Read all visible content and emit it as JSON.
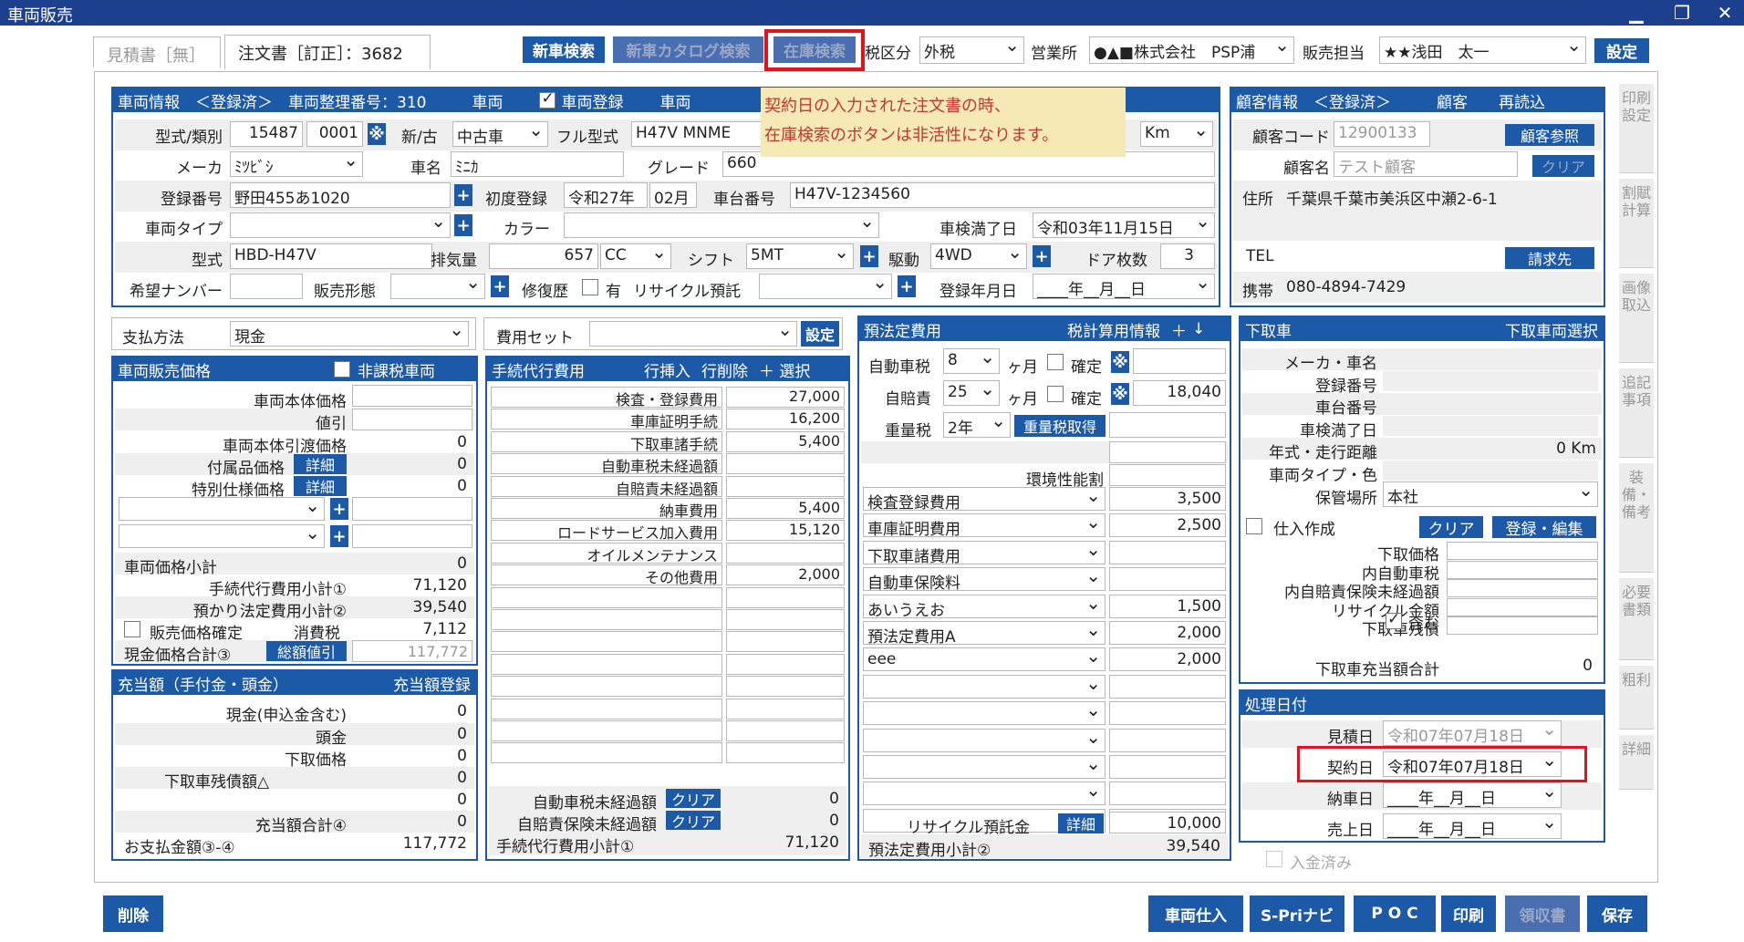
{
  "window": {
    "title": "車両販売",
    "minimize": "▁",
    "restore": "❐",
    "close": "✕"
  },
  "tabs": [
    {
      "label": "見積書［無］"
    },
    {
      "label": "注文書［訂正］：3682"
    }
  ],
  "toolbar": {
    "new_car_search": "新車検索",
    "catalog_search": "新車カタログ検索",
    "stock_search": "在庫検索",
    "tax_label": "税区分",
    "tax_value": "外税",
    "office_label": "営業所",
    "office_value": "●▲■株式会社　PSP浦",
    "sales_label": "販売担当",
    "sales_value": "★★浅田　太一",
    "settings": "設定"
  },
  "tooltip": {
    "line1": "契約日の入力された注文書の時、",
    "line2": "在庫検索のボタンは非活性になります。"
  },
  "vehicle": {
    "header": "車両情報　＜登録済＞　車両整理番号：310",
    "h_vehicle": "車両",
    "h_reg": "車両登録",
    "h_vehicle2": "車両",
    "type_label": "型式/類別",
    "type1": "15487",
    "type2": "0001",
    "newold_label": "新/古",
    "newold": "中古車",
    "full_type_label": "フル型式",
    "full_type": "H47V MNME",
    "unit": "Km",
    "maker_label": "メーカ",
    "maker": "ﾐﾂﾋﾞｼ",
    "name_label": "車名",
    "name": "ﾐﾆｶ",
    "grade_label": "グレード",
    "grade": "660",
    "regno_label": "登録番号",
    "regno": "野田455あ1020",
    "first_reg_label": "初度登録",
    "first_reg_era": "令和27年",
    "first_reg_month": "02月",
    "chassis_label": "車台番号",
    "chassis": "H47V-1234560",
    "vtype_label": "車両タイプ",
    "color_label": "カラー",
    "inspection_label": "車検満了日",
    "inspection": "令和03年11月15日",
    "model_label": "型式",
    "model": "HBD-H47V",
    "displacement_label": "排気量",
    "displacement": "657",
    "cc": "CC",
    "shift_label": "シフト",
    "shift": "5MT",
    "drive_label": "駆動",
    "drive": "4WD",
    "doors_label": "ドア枚数",
    "doors": "3",
    "wish_label": "希望ナンバー",
    "sales_form_label": "販売形態",
    "repair_label": "修復歴",
    "repair_has": "有",
    "recycle_label": "リサイクル預託",
    "reg_date_label": "登録年月日",
    "reg_date": "____年__月__日"
  },
  "customer": {
    "header": "顧客情報　＜登録済＞",
    "h_customer": "顧客",
    "h_reload": "再読込",
    "code_label": "顧客コード",
    "code": "12900133",
    "ref_btn": "顧客参照",
    "name_label": "顧客名",
    "name": "テスト顧客",
    "clear": "クリア",
    "addr_label": "住所",
    "addr": "千葉県千葉市美浜区中瀬2-6-1",
    "tel_label": "TEL",
    "bill_btn": "請求先",
    "mobile_label": "携帯",
    "mobile": "080-4894-7429"
  },
  "side_tabs": [
    "印刷設定",
    "割賦計算",
    "画像取込",
    "追記事項",
    "装備・備考",
    "必要書類",
    "粗利",
    "詳細"
  ],
  "payment": {
    "label": "支払方法",
    "value": "現金"
  },
  "cost_set": {
    "label": "費用セット",
    "btn": "設定"
  },
  "price": {
    "header": "車両販売価格",
    "nontax": "非課税車両",
    "items": [
      {
        "label": "車両本体価格",
        "value": ""
      },
      {
        "label": "値引",
        "value": ""
      },
      {
        "label": "車両本体引渡価格",
        "value": "0"
      },
      {
        "label": "付属品価格",
        "value": "0",
        "btn": "詳細"
      },
      {
        "label": "特別仕様価格",
        "value": "0",
        "btn": "詳細"
      }
    ],
    "subtotal_label": "車両価格小計",
    "subtotal": "0",
    "proc_label": "手続代行費用小計①",
    "proc": "71,120",
    "deposit_label": "預かり法定費用小計②",
    "deposit": "39,540",
    "confirm_label": "販売価格確定",
    "tax_label": "消費税",
    "tax": "7,112",
    "cash_total_label": "現金価格合計③",
    "discount_btn": "総額値引",
    "cash_total": "117,772"
  },
  "allot": {
    "header": "充当額（手付金・頭金）",
    "reg_btn": "充当額登録",
    "items": [
      {
        "label": "現金(申込金含む)",
        "value": "0"
      },
      {
        "label": "頭金",
        "value": "0"
      },
      {
        "label": "下取価格",
        "value": "0"
      },
      {
        "label": "下取車残債額△",
        "value": "0"
      },
      {
        "label": "",
        "value": "0"
      },
      {
        "label": "充当額合計④",
        "value": "0"
      }
    ],
    "pay_label": "お支払金額③-④",
    "pay": "117,772"
  },
  "proc": {
    "header": "手続代行費用",
    "insert": "行挿入",
    "delete": "行削除",
    "select": "＋ 選択",
    "rows": [
      {
        "label": "検査・登録費用",
        "value": "27,000"
      },
      {
        "label": "車庫証明手続",
        "value": "16,200"
      },
      {
        "label": "下取車諸手続",
        "value": "5,400"
      },
      {
        "label": "自動車税未経過額",
        "value": ""
      },
      {
        "label": "自賠責未経過額",
        "value": ""
      },
      {
        "label": "納車費用",
        "value": "5,400"
      },
      {
        "label": "ロードサービス加入費用",
        "value": "15,120"
      },
      {
        "label": "オイルメンテナンス",
        "value": ""
      },
      {
        "label": "その他費用",
        "value": "2,000"
      }
    ],
    "car_tax_label": "自動車税未経過額",
    "ins_label": "自賠責保険未経過額",
    "clear": "クリア",
    "car_tax": "0",
    "ins": "0",
    "sub_label": "手続代行費用小計①",
    "sub": "71,120"
  },
  "legal": {
    "header": "預法定費用",
    "tax_info": "税計算用情報",
    "car_tax_label": "自動車税",
    "car_tax_sel": "8",
    "month": "ヶ月",
    "confirm": "確定",
    "ins_label": "自賠責",
    "ins_sel": "25",
    "ins_value": "18,040",
    "weight_label": "重量税",
    "weight_sel": "2年",
    "weight_btn": "重量税取得",
    "env_label": "環境性能割",
    "rows": [
      {
        "label": "検査登録費用",
        "value": "3,500"
      },
      {
        "label": "車庫証明費用",
        "value": "2,500"
      },
      {
        "label": "下取車諸費用",
        "value": ""
      },
      {
        "label": "自動車保険料",
        "value": ""
      },
      {
        "label": "あいうえお",
        "value": "1,500"
      },
      {
        "label": "預法定費用A",
        "value": "2,000"
      },
      {
        "label": "eee",
        "value": "2,000"
      }
    ],
    "recycle_label": "リサイクル預託金",
    "detail": "詳細",
    "recycle": "10,000",
    "sub_label": "預法定費用小計②",
    "sub": "39,540"
  },
  "tradein": {
    "header": "下取車",
    "select": "下取車両選択",
    "labels": [
      "メーカ・車名",
      "登録番号",
      "車台番号",
      "車検満了日",
      "年式・走行距離",
      "車両タイプ・色"
    ],
    "km": "0 Km",
    "storage_label": "保管場所",
    "storage": "本社",
    "purchase": "仕入作成",
    "clear": "クリア",
    "reg_edit": "登録・編集",
    "price_labels": [
      "下取価格",
      "内自動車税",
      "内自賠責保険未経過額",
      "リサイクル金額",
      "下取車残債"
    ],
    "included": "含む",
    "total_label": "下取車充当額合計",
    "total": "0"
  },
  "dates": {
    "header": "処理日付",
    "estimate_label": "見積日",
    "estimate": "令和07年07月18日",
    "contract_label": "契約日",
    "contract": "令和07年07月18日",
    "delivery_label": "納車日",
    "delivery": "____年__月__日",
    "sales_label": "売上日",
    "sales": "____年__月__日",
    "paid": "入金済み"
  },
  "footer": {
    "delete": "削除",
    "purchase": "車両仕入",
    "spri": "S-Priナビ",
    "poc": "P O C",
    "print": "印刷",
    "receipt": "領収書",
    "save": "保存"
  },
  "colors": {
    "accent": "#1c5aa8",
    "highlight": "#e0141e",
    "tooltip": "#f5e9b5"
  }
}
